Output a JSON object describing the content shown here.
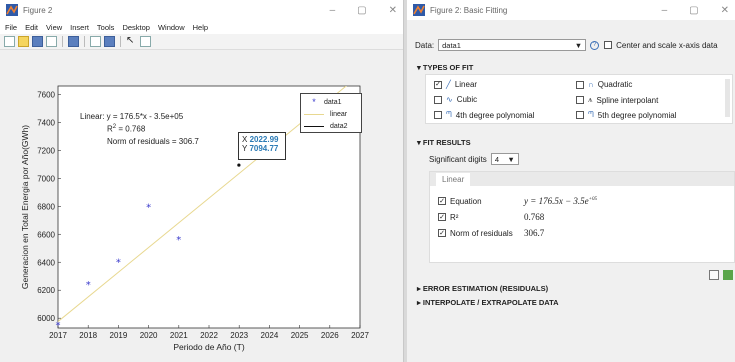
{
  "figure": {
    "title": "Figure 2",
    "menu": [
      "File",
      "Edit",
      "View",
      "Insert",
      "Tools",
      "Desktop",
      "Window",
      "Help"
    ],
    "annotation": {
      "line1": "Linear:  y = 176.5*x - 3.5e+05",
      "line2": "R",
      "line2_sup": "2",
      "line2_rest": " = 0.768",
      "line3": "Norm of residuals = 306.7"
    },
    "datatip": {
      "x_label": "X",
      "x_value": "2022.99",
      "y_label": "Y",
      "y_value": "7094.77"
    },
    "legend": [
      "data1",
      "linear",
      "data2"
    ]
  },
  "chart_data": {
    "type": "scatter",
    "xlabel": "Periodo de Año (T)",
    "ylabel": "Generacion en Total Energia por Año(GWh)",
    "xlim": [
      2017,
      2027
    ],
    "ylim": [
      5930,
      7660
    ],
    "xticks": [
      "2017",
      "2018",
      "2019",
      "2020",
      "2021",
      "2022",
      "2023",
      "2024",
      "2025",
      "2026",
      "2027"
    ],
    "yticks": [
      "6000",
      "6200",
      "6400",
      "6600",
      "6800",
      "7000",
      "7200",
      "7400",
      "7600"
    ],
    "series": [
      {
        "name": "data1",
        "marker": "*",
        "color": "#3a3acc",
        "x": [
          2017,
          2018,
          2019,
          2020,
          2021
        ],
        "y": [
          5955,
          6245,
          6405,
          6800,
          6565
        ]
      },
      {
        "name": "linear",
        "kind": "line",
        "color": "#e8d890",
        "x": [
          2017,
          2027
        ],
        "y": [
          5976,
          7741
        ]
      },
      {
        "name": "data2",
        "marker": "dot",
        "color": "#111111",
        "x": [
          2022.99
        ],
        "y": [
          7094.77
        ]
      }
    ]
  },
  "basic_fitting": {
    "title": "Figure 2: Basic Fitting",
    "data_label": "Data:",
    "data_value": "data1",
    "center_scale_label": "Center and scale x-axis data",
    "types_header": "TYPES OF FIT",
    "types": [
      {
        "label": "Linear",
        "checked": true
      },
      {
        "label": "Quadratic",
        "checked": false
      },
      {
        "label": "Cubic",
        "checked": false
      },
      {
        "label": "Spline interpolant",
        "checked": false
      },
      {
        "label": "4th degree polynomial",
        "checked": false
      },
      {
        "label": "5th degree polynomial",
        "checked": false
      }
    ],
    "results_header": "FIT RESULTS",
    "sig_digits_label": "Significant digits",
    "sig_digits_value": "4",
    "results_tab": "Linear",
    "results": [
      {
        "label": "Equation",
        "value": "y = 176.5x − 3.5e",
        "sup": "+05"
      },
      {
        "label": "R²",
        "value": "0.768"
      },
      {
        "label": "Norm of residuals",
        "value": "306.7"
      }
    ],
    "error_header": "ERROR ESTIMATION (RESIDUALS)",
    "interp_header": "INTERPOLATE / EXTRAPOLATE DATA"
  }
}
